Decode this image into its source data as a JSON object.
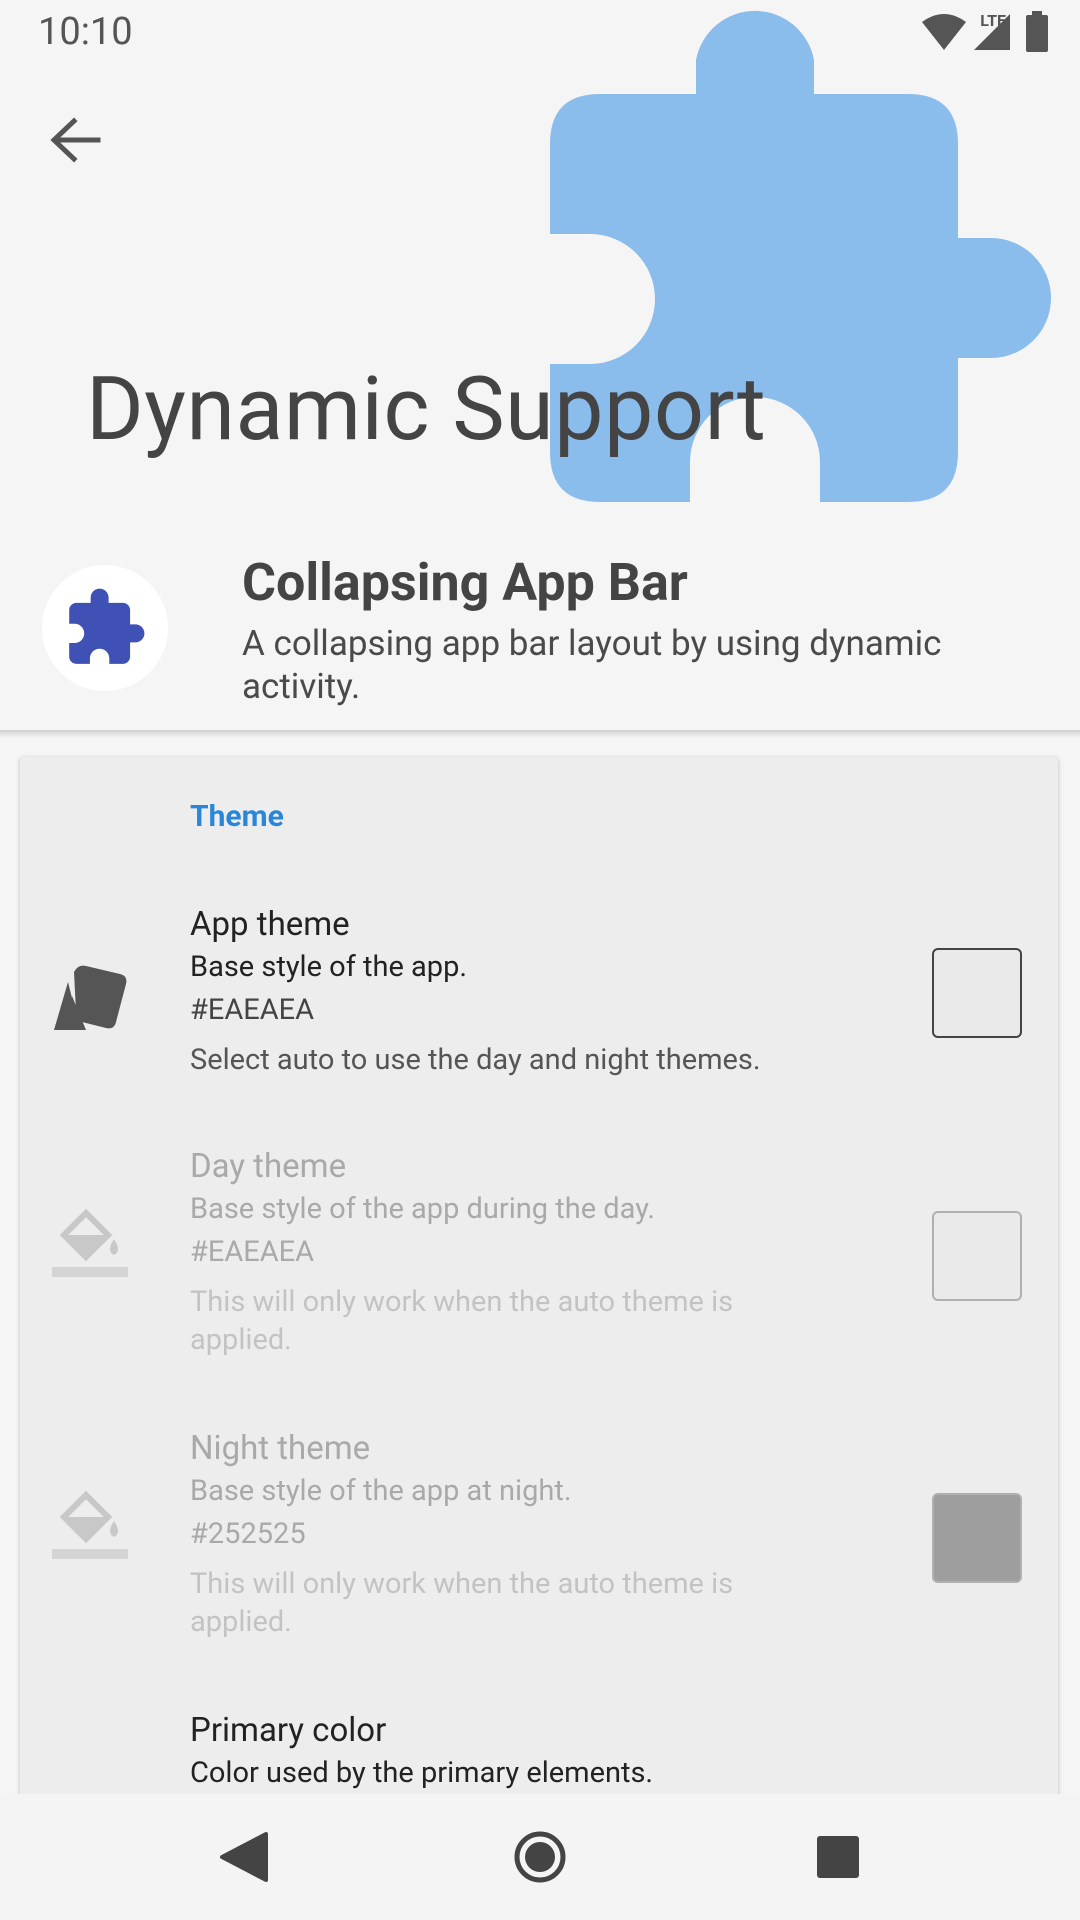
{
  "status_bar": {
    "time": "10:10",
    "network": "LTE"
  },
  "header": {
    "app_name": "Dynamic Support",
    "icon_color": "#8bbdec"
  },
  "info": {
    "title": "Collapsing App Bar",
    "description": "A collapsing app bar layout by using dynamic activity.",
    "icon_color": "#3f51b5"
  },
  "section": {
    "title": "Theme",
    "accent": "#2a87d8"
  },
  "prefs": [
    {
      "title": "App theme",
      "summary": "Base style of the app.",
      "value": "#EAEAEA",
      "description": "Select auto to use the day and night themes.",
      "swatch_color": "#EAEAEA",
      "icon": "palette-icon",
      "enabled": true
    },
    {
      "title": "Day theme",
      "summary": "Base style of the app during the day.",
      "value": "#EAEAEA",
      "description": "This will only work when the auto theme is applied.",
      "swatch_color": "#EAEAEA",
      "icon": "paint-bucket-icon",
      "enabled": false
    },
    {
      "title": "Night theme",
      "summary": "Base style of the app at night.",
      "value": "#252525",
      "description": "This will only work when the auto theme is applied.",
      "swatch_color": "#9e9e9e",
      "icon": "paint-bucket-icon",
      "enabled": false
    },
    {
      "title": "Primary color",
      "summary": "Color used by the primary elements.",
      "enabled": true
    }
  ]
}
